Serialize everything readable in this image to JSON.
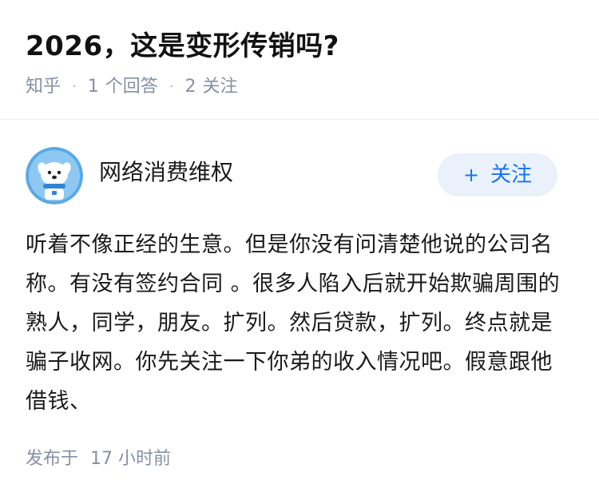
{
  "question": {
    "title": "2026，这是变形传销吗?",
    "source": "知乎",
    "answer_count": "1",
    "answer_label": "个回答",
    "follow_count": "2",
    "follow_label": "关注"
  },
  "answer": {
    "author": {
      "name": "网络消费维权",
      "avatar_icon": "cartoon-dog-avatar-icon"
    },
    "follow_button": {
      "icon": "+",
      "label": "关注"
    },
    "content": "听着不像正经的生意。但是你没有问清楚他说的公司名称。有没有签约合同 。很多人陷入后就开始欺骗周围的熟人，同学，朋友。扩列。然后贷款，扩列。终点就是骗子收网。你先关注一下你弟的收入情况吧。假意跟他借钱、",
    "published_label": "发布于",
    "published_time": "17 小时前"
  },
  "colors": {
    "accent": "#1772f6",
    "follow_bg": "#eaf1fb",
    "meta": "#8590a6",
    "avatar_bg": "#5aa9e6"
  }
}
